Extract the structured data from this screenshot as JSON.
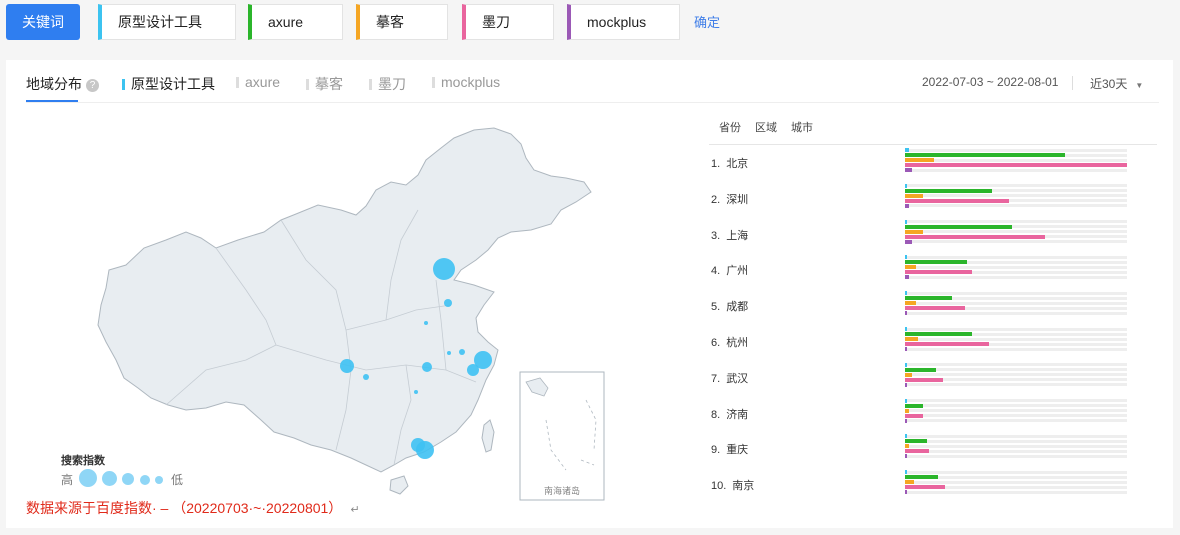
{
  "toolbar": {
    "keyword_button": "关键词",
    "chips": [
      {
        "label": "原型设计工具",
        "color": "#3cc3f0"
      },
      {
        "label": "axure",
        "color": "#2bb52b"
      },
      {
        "label": "摹客",
        "color": "#f5a623"
      },
      {
        "label": "墨刀",
        "color": "#e9659e"
      },
      {
        "label": "mockplus",
        "color": "#9b59b6"
      }
    ],
    "confirm": "确定"
  },
  "panel": {
    "tab_title": "地域分布",
    "help": "?",
    "series_tabs": [
      "原型设计工具",
      "axure",
      "摹客",
      "墨刀",
      "mockplus"
    ],
    "date_range": "2022-07-03 ~ 2022-08-01",
    "period": "近30天",
    "caret": "▼"
  },
  "legend": {
    "title": "搜索指数",
    "high": "高",
    "low": "低"
  },
  "map_label": "南海诸岛",
  "note": "数据来源于百度指数· – （20220703·~·20220801）",
  "note_mark": "↵",
  "rank_tabs": [
    "省份",
    "区域",
    "城市"
  ],
  "cities": [
    {
      "rank": "1.",
      "name": "北京",
      "values": [
        0.02,
        0.72,
        0.13,
        1.0,
        0.03
      ]
    },
    {
      "rank": "2.",
      "name": "深圳",
      "values": [
        0.01,
        0.39,
        0.08,
        0.47,
        0.02
      ]
    },
    {
      "rank": "3.",
      "name": "上海",
      "values": [
        0.01,
        0.48,
        0.08,
        0.63,
        0.03
      ]
    },
    {
      "rank": "4.",
      "name": "广州",
      "values": [
        0.01,
        0.28,
        0.05,
        0.3,
        0.02
      ]
    },
    {
      "rank": "5.",
      "name": "成都",
      "values": [
        0.01,
        0.21,
        0.05,
        0.27,
        0.01
      ]
    },
    {
      "rank": "6.",
      "name": "杭州",
      "values": [
        0.01,
        0.3,
        0.06,
        0.38,
        0.01
      ]
    },
    {
      "rank": "7.",
      "name": "武汉",
      "values": [
        0.005,
        0.14,
        0.03,
        0.17,
        0.01
      ]
    },
    {
      "rank": "8.",
      "name": "济南",
      "values": [
        0.005,
        0.08,
        0.02,
        0.08,
        0.01
      ]
    },
    {
      "rank": "9.",
      "name": "重庆",
      "values": [
        0.005,
        0.1,
        0.02,
        0.11,
        0.01
      ]
    },
    {
      "rank": "10.",
      "name": "南京",
      "values": [
        0.005,
        0.15,
        0.04,
        0.18,
        0.01
      ]
    }
  ]
}
